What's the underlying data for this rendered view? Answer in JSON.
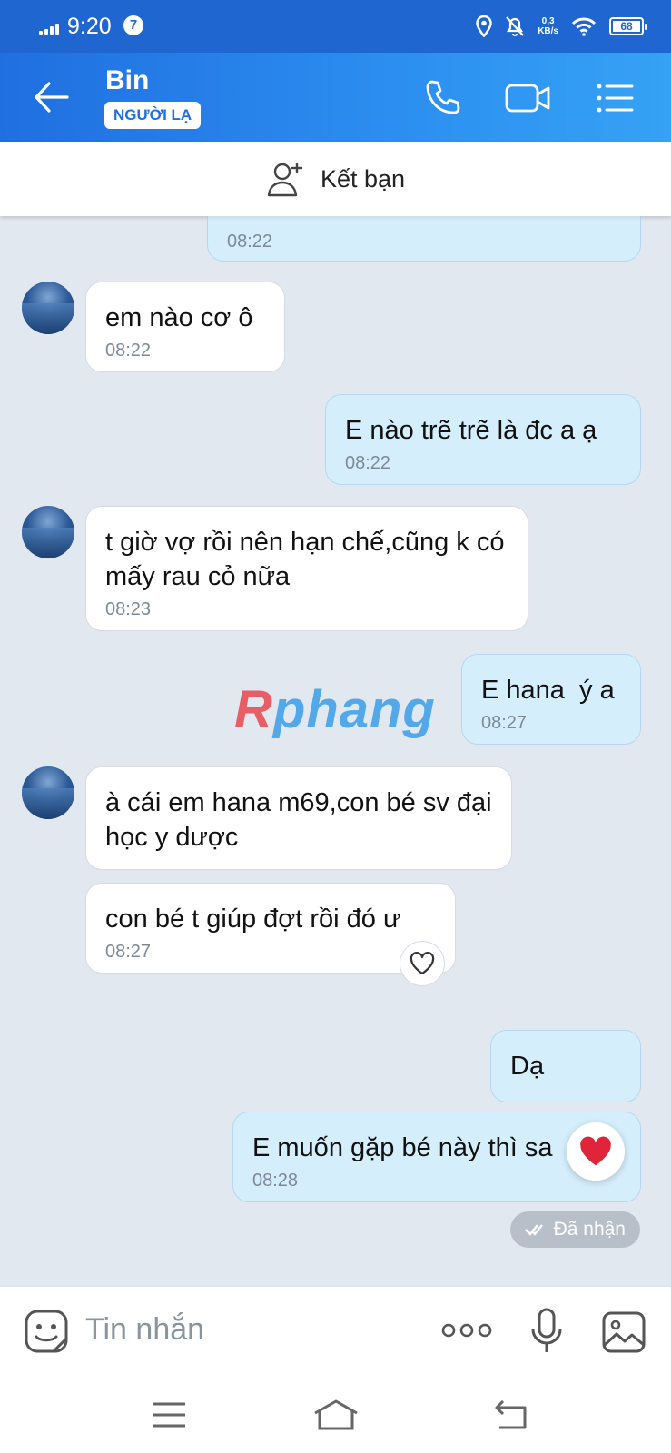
{
  "status_bar": {
    "time": "9:20",
    "notification_count": "7",
    "net_speed_value": "0,3",
    "net_speed_unit": "KB/s",
    "battery": "68"
  },
  "header": {
    "contact_name": "Bin",
    "contact_badge": "NGƯỜI LẠ"
  },
  "add_friend": {
    "label": "Kết bạn"
  },
  "messages": [
    {
      "side": "out",
      "text": "",
      "time": "08:22"
    },
    {
      "side": "in",
      "text": "em nào cơ ô",
      "time": "08:22"
    },
    {
      "side": "out",
      "text": "E nào trẽ trẽ là đc a ạ",
      "time": "08:22"
    },
    {
      "side": "in",
      "text": "t giờ vợ rồi nên hạn chế,cũng k có mấy rau cỏ nữa",
      "time": "08:23"
    },
    {
      "side": "out",
      "text": "E hana  ý a",
      "time": "08:27"
    },
    {
      "side": "in",
      "text": "à cái em hana m69,con bé sv đại học y dược",
      "time": ""
    },
    {
      "side": "in",
      "text": "con bé t giúp đợt rồi đó ư",
      "time": "08:27"
    },
    {
      "side": "out",
      "text": "Dạ",
      "time": ""
    },
    {
      "side": "out",
      "text": "E muốn gặp bé này thì sa",
      "time": "08:28"
    }
  ],
  "watermark": {
    "part1": "R",
    "part2": "phang"
  },
  "delivery_status": "Đã nhận",
  "composer": {
    "placeholder": "Tin nhắn"
  },
  "colors": {
    "header": "#1f6fe0",
    "bubble_out": "#d5eefc",
    "bubble_in": "#ffffff",
    "background": "#e2e8f0"
  }
}
